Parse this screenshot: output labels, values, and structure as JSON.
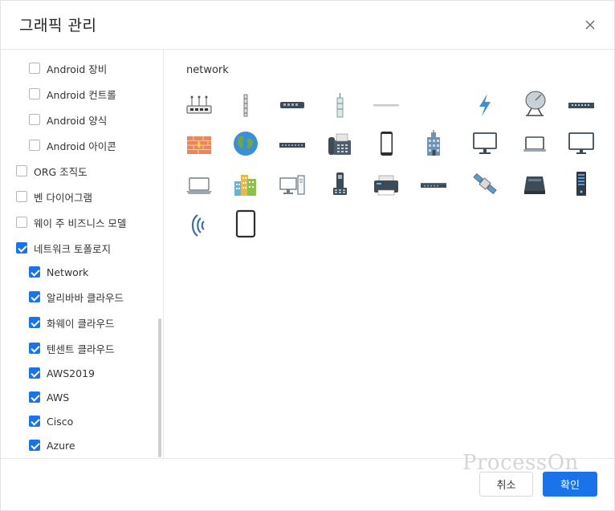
{
  "dialog": {
    "title": "그래픽 관리"
  },
  "sidebar": {
    "items": [
      {
        "label": "Android 장비",
        "checked": false
      },
      {
        "label": "Android 컨트롤",
        "checked": false
      },
      {
        "label": "Android 양식",
        "checked": false
      },
      {
        "label": "Android 아이콘",
        "checked": false
      },
      {
        "label": "ORG 조직도",
        "checked": false
      },
      {
        "label": "벤 다이어그램",
        "checked": false
      },
      {
        "label": "웨이 주 비즈니스 모델",
        "checked": false
      },
      {
        "label": "네트워크 토폴로지",
        "checked": true
      },
      {
        "label": "Network",
        "checked": true
      },
      {
        "label": "알리바바 클라우드",
        "checked": true
      },
      {
        "label": "화웨이 클라우드",
        "checked": true
      },
      {
        "label": "텐센트 클라우드",
        "checked": true
      },
      {
        "label": "AWS2019",
        "checked": true
      },
      {
        "label": "AWS",
        "checked": true
      },
      {
        "label": "Cisco",
        "checked": true
      },
      {
        "label": "Azure",
        "checked": true
      }
    ]
  },
  "content": {
    "category": "network",
    "shapes": [
      "router-icon",
      "antenna-icon",
      "switch-icon",
      "radio-tower-icon",
      "cable-icon",
      "blank-icon",
      "lightning-icon",
      "satellite-dish-icon",
      "patch-panel-icon",
      "firewall-icon",
      "globe-icon",
      "rack-switch-icon",
      "fax-machine-icon",
      "mobile-phone-icon",
      "office-building-icon",
      "monitor-icon",
      "laptop-icon",
      "display-icon",
      "notebook-icon",
      "city-buildings-icon",
      "desktop-computer-icon",
      "ip-phone-icon",
      "printer-icon",
      "rack-unit-icon",
      "satellite-icon",
      "scanner-icon",
      "server-tower-icon",
      "wireless-signal-icon",
      "tablet-icon"
    ]
  },
  "footer": {
    "cancel_label": "취소",
    "ok_label": "확인",
    "watermark": "ProcessOn"
  },
  "colors": {
    "accent": "#1a73e8",
    "border": "#e8e8e8",
    "icon_dark": "#2c3e50",
    "icon_blue": "#3b8fd4"
  }
}
